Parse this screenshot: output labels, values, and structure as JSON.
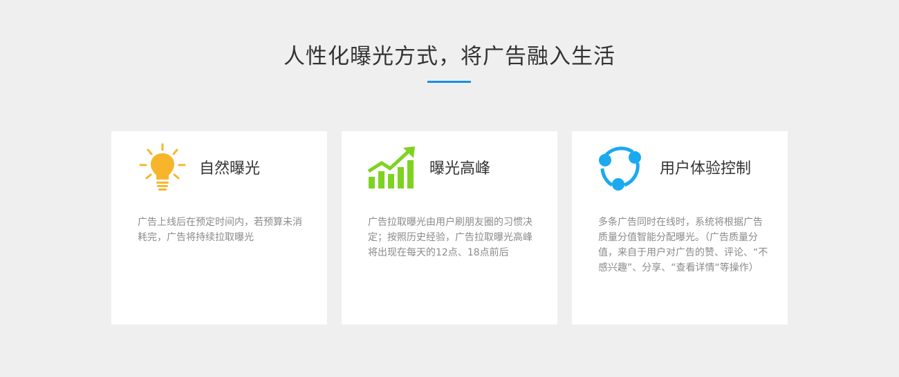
{
  "section": {
    "title": "人性化曝光方式，将广告融入生活"
  },
  "cards": [
    {
      "icon": "lightbulb-icon",
      "icon_color": "#f7b52c",
      "title": "自然曝光",
      "description": "广告上线后在预定时间内，若预算未消耗完，广告将持续拉取曝光"
    },
    {
      "icon": "growth-chart-icon",
      "icon_color": "#7ed321",
      "title": "曝光高峰",
      "description": "广告拉取曝光由用户刷朋友圈的习惯决定；按照历史经验，广告拉取曝光高峰将出现在每天的12点、18点前后"
    },
    {
      "icon": "share-network-icon",
      "icon_color": "#1ba9ef",
      "title": "用户体验控制",
      "description": "多条广告同时在线时，系统将根据广告质量分值智能分配曝光。（广告质量分值，来自于用户对广告的赞、评论、“不感兴趣”、分享、“查看详情“等操作）"
    }
  ],
  "colors": {
    "background": "#efefef",
    "accent": "#1a8fe0",
    "card_background": "#ffffff"
  }
}
